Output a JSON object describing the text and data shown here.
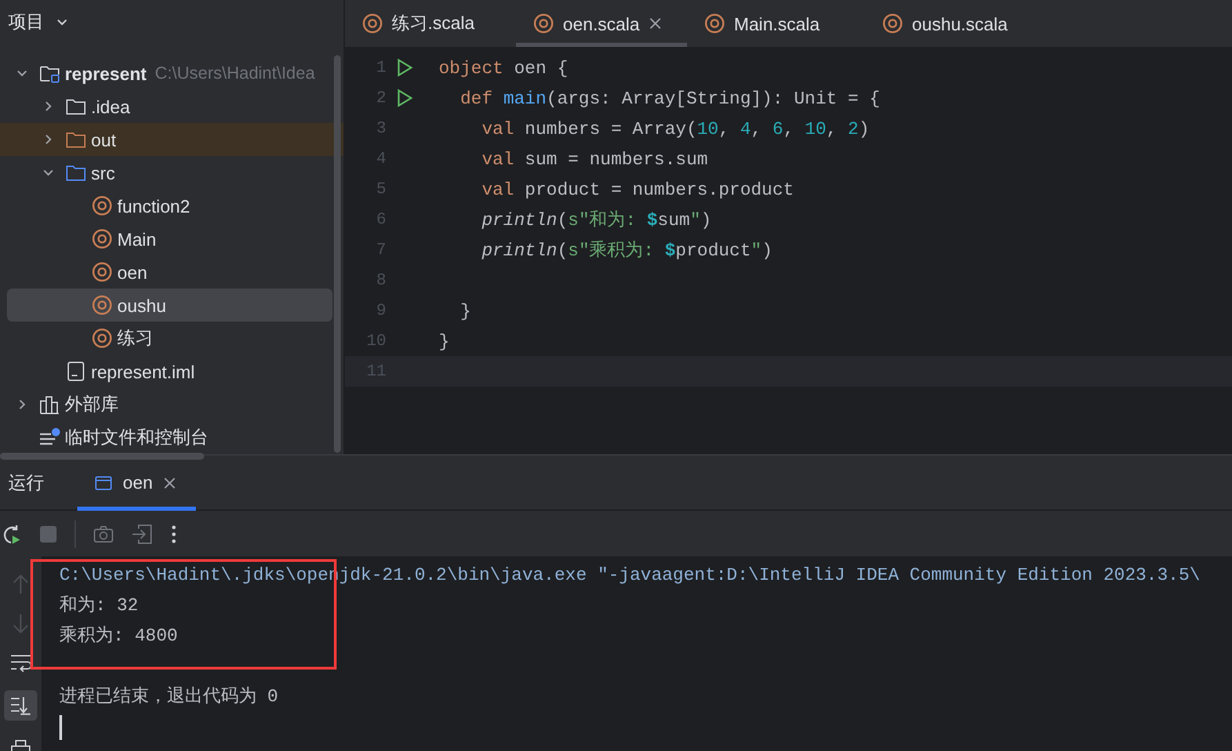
{
  "project_panel": {
    "title": "项目",
    "tree": [
      {
        "label": "represent",
        "hint": "C:\\Users\\Hadint\\Idea",
        "kind": "module",
        "expanded": true,
        "selected": false,
        "children": [
          {
            "label": ".idea",
            "kind": "folder",
            "expanded": false,
            "selected": false
          },
          {
            "label": "out",
            "kind": "excluded-folder",
            "expanded": false,
            "selected": false
          },
          {
            "label": "src",
            "kind": "source-folder",
            "expanded": true,
            "selected": false,
            "children": [
              {
                "label": "function2",
                "kind": "scala",
                "selected": false
              },
              {
                "label": "Main",
                "kind": "scala",
                "selected": false
              },
              {
                "label": "oen",
                "kind": "scala",
                "selected": false
              },
              {
                "label": "oushu",
                "kind": "scala",
                "selected": true
              },
              {
                "label": "练习",
                "kind": "scala",
                "selected": false
              }
            ]
          },
          {
            "label": "represent.iml",
            "kind": "iml",
            "selected": false
          }
        ]
      },
      {
        "label": "外部库",
        "kind": "library",
        "expanded": false,
        "selected": false
      },
      {
        "label": "临时文件和控制台",
        "kind": "scratch",
        "selected": false
      }
    ]
  },
  "editor": {
    "tabs": [
      {
        "label": "练习.scala",
        "selected": false
      },
      {
        "label": "oen.scala",
        "selected": true
      },
      {
        "label": "Main.scala",
        "selected": false
      },
      {
        "label": "oushu.scala",
        "selected": false
      }
    ],
    "lines": [
      {
        "number": "1",
        "run": true,
        "current": false,
        "tokens": [
          {
            "text": "object ",
            "kind": "kw"
          },
          {
            "text": "oen {",
            "kind": "plain"
          }
        ]
      },
      {
        "number": "2",
        "run": true,
        "current": false,
        "tokens": [
          {
            "text": "  def ",
            "kind": "kw"
          },
          {
            "text": "main",
            "kind": "fn"
          },
          {
            "text": "(args: Array[String]): Unit = {",
            "kind": "plain"
          }
        ]
      },
      {
        "number": "3",
        "current": false,
        "tokens": [
          {
            "text": "    val ",
            "kind": "kw"
          },
          {
            "text": "numbers = Array(",
            "kind": "plain"
          },
          {
            "text": "10",
            "kind": "num"
          },
          {
            "text": ", ",
            "kind": "plain"
          },
          {
            "text": "4",
            "kind": "num"
          },
          {
            "text": ", ",
            "kind": "plain"
          },
          {
            "text": "6",
            "kind": "num"
          },
          {
            "text": ", ",
            "kind": "plain"
          },
          {
            "text": "10",
            "kind": "num"
          },
          {
            "text": ", ",
            "kind": "plain"
          },
          {
            "text": "2",
            "kind": "num"
          },
          {
            "text": ")",
            "kind": "plain"
          }
        ]
      },
      {
        "number": "4",
        "current": false,
        "tokens": [
          {
            "text": "    val ",
            "kind": "kw"
          },
          {
            "text": "sum = numbers.sum",
            "kind": "plain"
          }
        ]
      },
      {
        "number": "5",
        "current": false,
        "tokens": [
          {
            "text": "    val ",
            "kind": "kw"
          },
          {
            "text": "product = numbers.product",
            "kind": "plain"
          }
        ]
      },
      {
        "number": "6",
        "current": false,
        "tokens": [
          {
            "text": "    println",
            "kind": "italic"
          },
          {
            "text": "(",
            "kind": "plain"
          },
          {
            "text": "s\"和为: ",
            "kind": "str"
          },
          {
            "text": "$",
            "kind": "interp"
          },
          {
            "text": "sum",
            "kind": "plain"
          },
          {
            "text": "\"",
            "kind": "str"
          },
          {
            "text": ")",
            "kind": "plain"
          }
        ]
      },
      {
        "number": "7",
        "current": false,
        "tokens": [
          {
            "text": "    println",
            "kind": "italic"
          },
          {
            "text": "(",
            "kind": "plain"
          },
          {
            "text": "s\"乘积为: ",
            "kind": "str"
          },
          {
            "text": "$",
            "kind": "interp"
          },
          {
            "text": "product",
            "kind": "plain"
          },
          {
            "text": "\"",
            "kind": "str"
          },
          {
            "text": ")",
            "kind": "plain"
          }
        ]
      },
      {
        "number": "8",
        "current": false
      },
      {
        "number": "9",
        "current": false,
        "tokens": [
          {
            "text": "  }",
            "kind": "plain"
          }
        ]
      },
      {
        "number": "10",
        "current": false,
        "tokens": [
          {
            "text": "}",
            "kind": "plain"
          }
        ]
      },
      {
        "number": "11",
        "current": true
      }
    ]
  },
  "run_panel": {
    "title": "运行",
    "tabs": [
      {
        "label": "oen",
        "selected": true
      }
    ],
    "console": [
      {
        "text": "C:\\Users\\Hadint\\.jdks\\openjdk-21.0.2\\bin\\java.exe \"-javaagent:D:\\IntelliJ IDEA Community Edition 2023.3.5\\",
        "kind": "command"
      },
      {
        "text": "和为: 32",
        "kind": "output"
      },
      {
        "text": "乘积为: 4800",
        "kind": "output"
      },
      {
        "text": "进程已结束，退出代码为 0",
        "kind": "exit"
      }
    ]
  }
}
